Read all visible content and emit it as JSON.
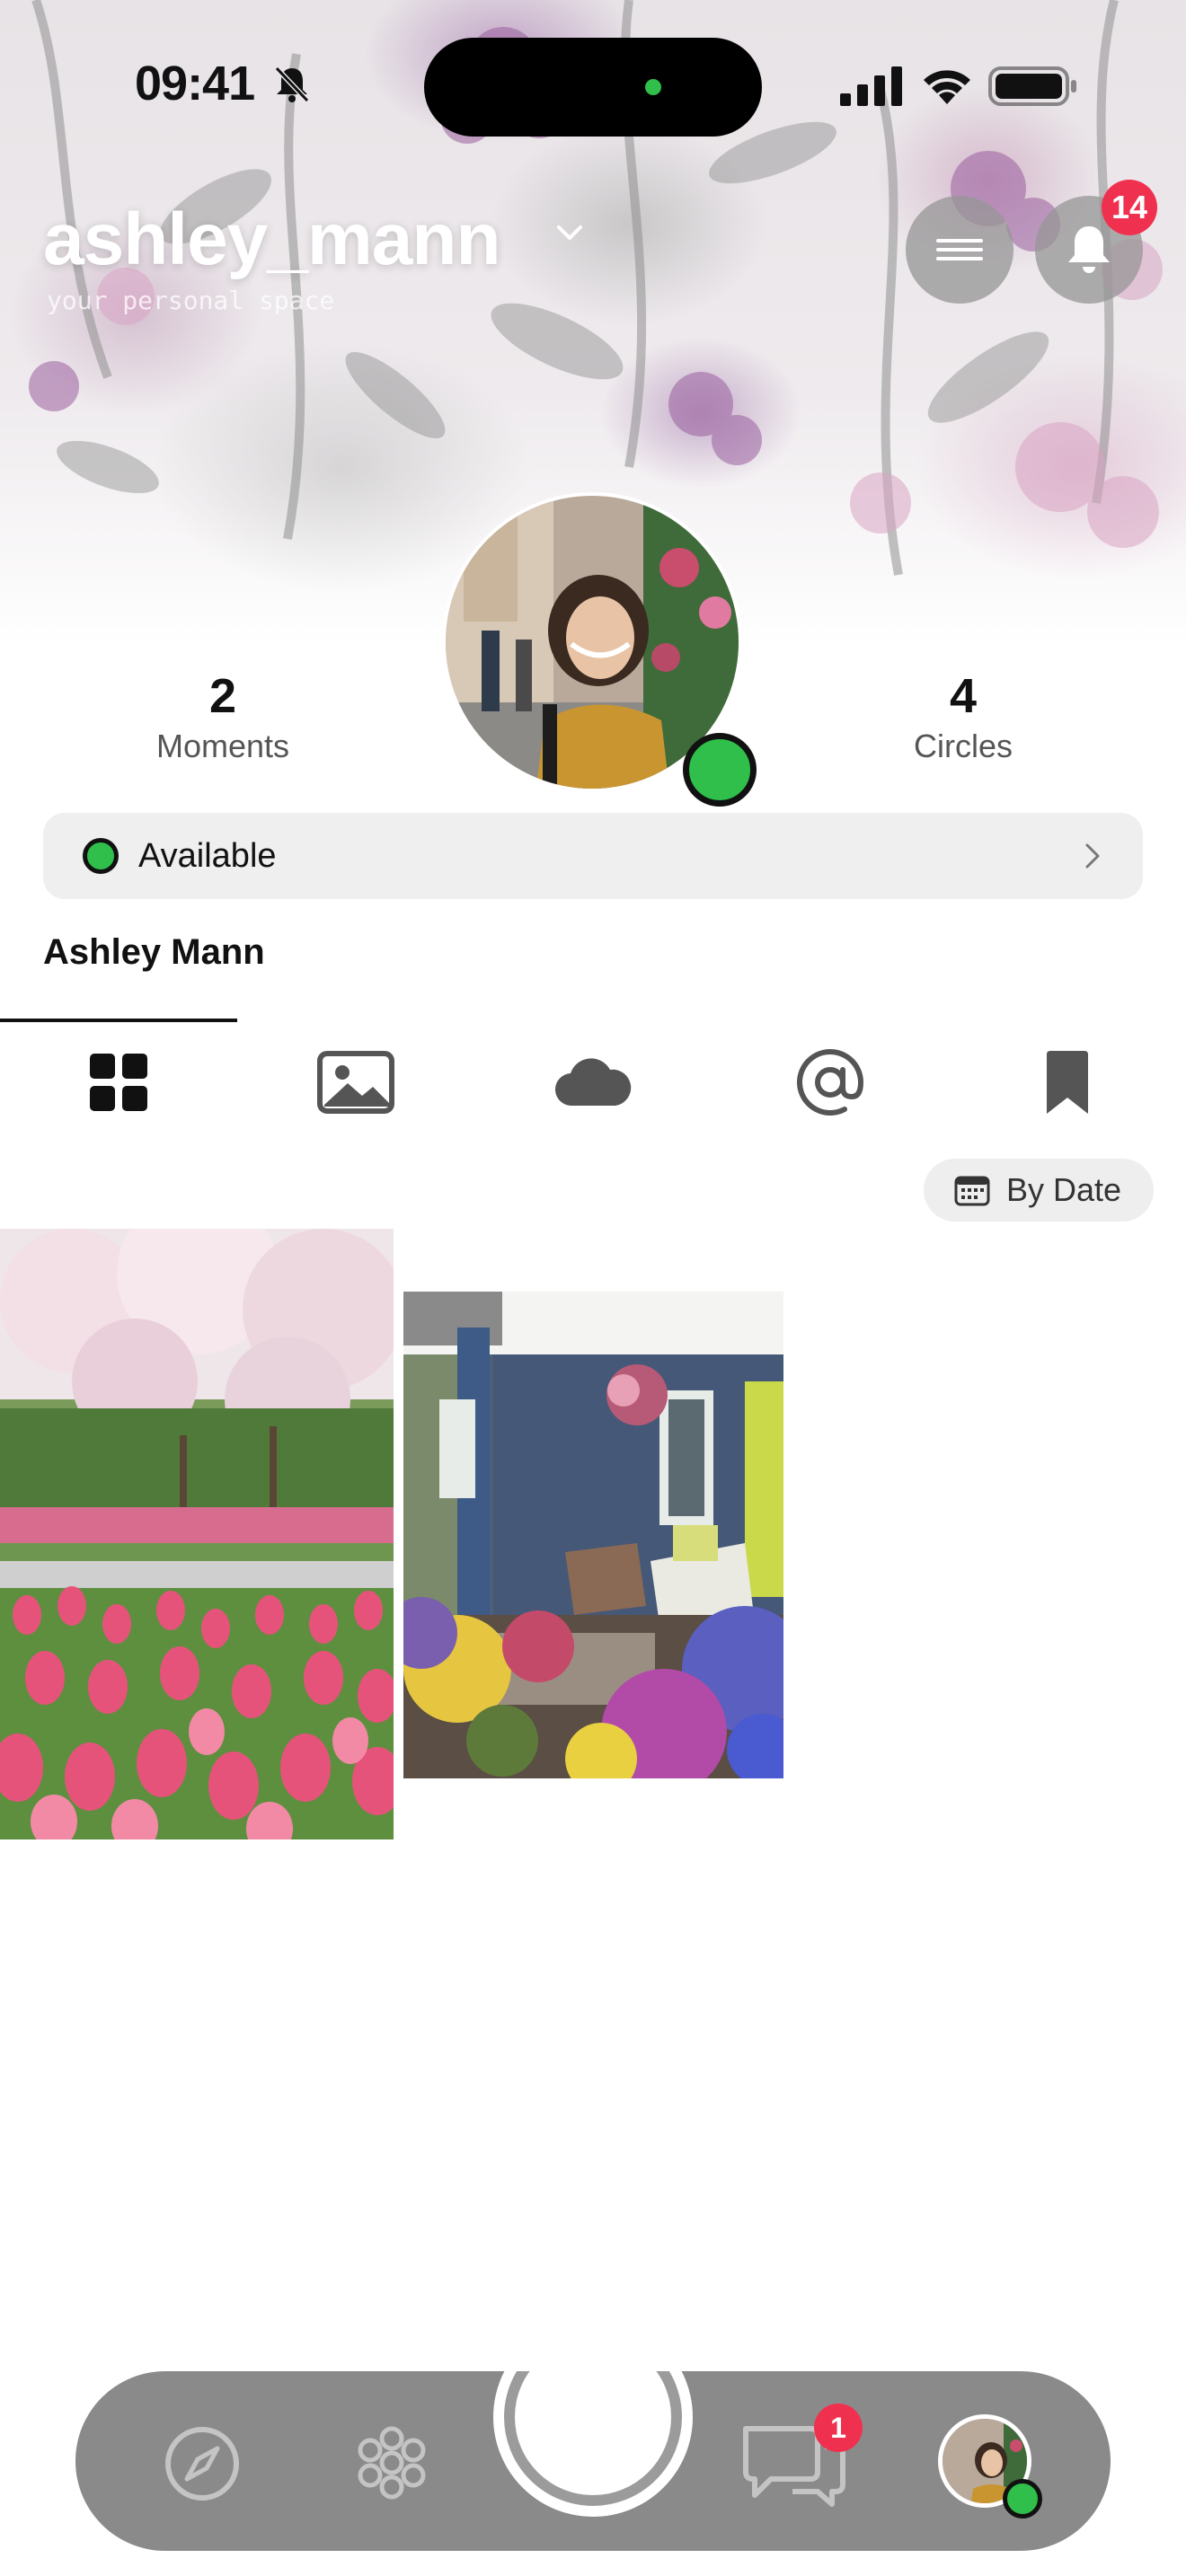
{
  "status_bar": {
    "time": "09:41",
    "icons": [
      "bell-slash-icon",
      "cellular-signal-icon",
      "wifi-icon",
      "battery-icon"
    ]
  },
  "header": {
    "username": "ashley_mann",
    "subtitle": "your personal space",
    "notification_count": "14",
    "icons": [
      "chevron-down-icon",
      "menu-icon",
      "bell-icon"
    ]
  },
  "profile": {
    "stats": [
      {
        "value": "2",
        "label": "Moments"
      },
      {
        "value": "4",
        "label": "Circles"
      }
    ],
    "status": "Available",
    "full_name": "Ashley Mann",
    "presence_color": "#2fbf4a"
  },
  "tabs": [
    {
      "icon": "grid-icon",
      "active": true
    },
    {
      "icon": "photo-icon",
      "active": false
    },
    {
      "icon": "cloud-icon",
      "active": false
    },
    {
      "icon": "at-sign-icon",
      "active": false
    },
    {
      "icon": "bookmark-icon",
      "active": false
    }
  ],
  "sort": {
    "label": "By Date",
    "icon": "calendar-icon"
  },
  "moments": [
    {
      "alt": "tulip-field-photo"
    },
    {
      "alt": "porch-flowers-photo"
    }
  ],
  "bottom_nav": {
    "items": [
      "compass-icon",
      "flower-icon",
      "camera-shutter",
      "chat-icon",
      "profile-avatar"
    ],
    "chat_badge": "1"
  },
  "colors": {
    "accent_badge": "#f0304f",
    "online": "#2fbf4a",
    "nav_bg": "#8a8a8a"
  }
}
